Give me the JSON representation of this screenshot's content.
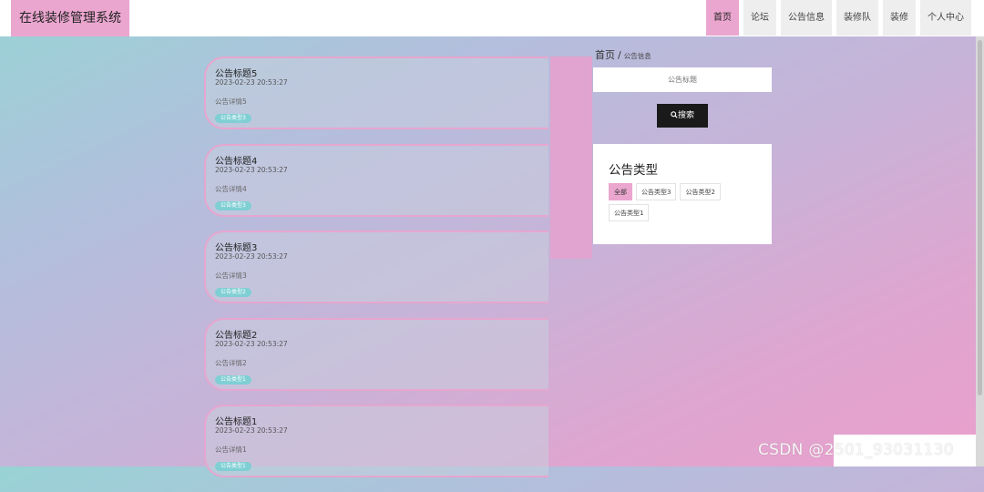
{
  "app": {
    "title": "在线装修管理系统"
  },
  "nav": [
    {
      "label": "首页",
      "active": true
    },
    {
      "label": "论坛",
      "active": false
    },
    {
      "label": "公告信息",
      "active": false
    },
    {
      "label": "装修队",
      "active": false
    },
    {
      "label": "装修",
      "active": false
    },
    {
      "label": "个人中心",
      "active": false
    }
  ],
  "notices": [
    {
      "title": "公告标题5",
      "time": "2023-02-23 20:53:27",
      "detail": "公告详情5",
      "type": "公告类型3"
    },
    {
      "title": "公告标题4",
      "time": "2023-02-23 20:53:27",
      "detail": "公告详情4",
      "type": "公告类型3"
    },
    {
      "title": "公告标题3",
      "time": "2023-02-23 20:53:27",
      "detail": "公告详情3",
      "type": "公告类型2"
    },
    {
      "title": "公告标题2",
      "time": "2023-02-23 20:53:27",
      "detail": "公告详情2",
      "type": "公告类型1"
    },
    {
      "title": "公告标题1",
      "time": "2023-02-23 20:53:27",
      "detail": "公告详情1",
      "type": "公告类型1"
    }
  ],
  "breadcrumb": {
    "home": "首页",
    "separator": "/",
    "current": "公告信息"
  },
  "search": {
    "placeholder": "公告标题",
    "button_label": "搜索"
  },
  "types": {
    "title": "公告类型",
    "options": [
      {
        "label": "全部",
        "active": true
      },
      {
        "label": "公告类型3",
        "active": false
      },
      {
        "label": "公告类型2",
        "active": false
      },
      {
        "label": "公告类型1",
        "active": false
      }
    ]
  },
  "watermark": "CSDN @2501_93031130",
  "colors": {
    "accent_pink": "#eba6cf",
    "tag_teal": "#7fcfd4",
    "search_button": "#1a1a1a"
  }
}
